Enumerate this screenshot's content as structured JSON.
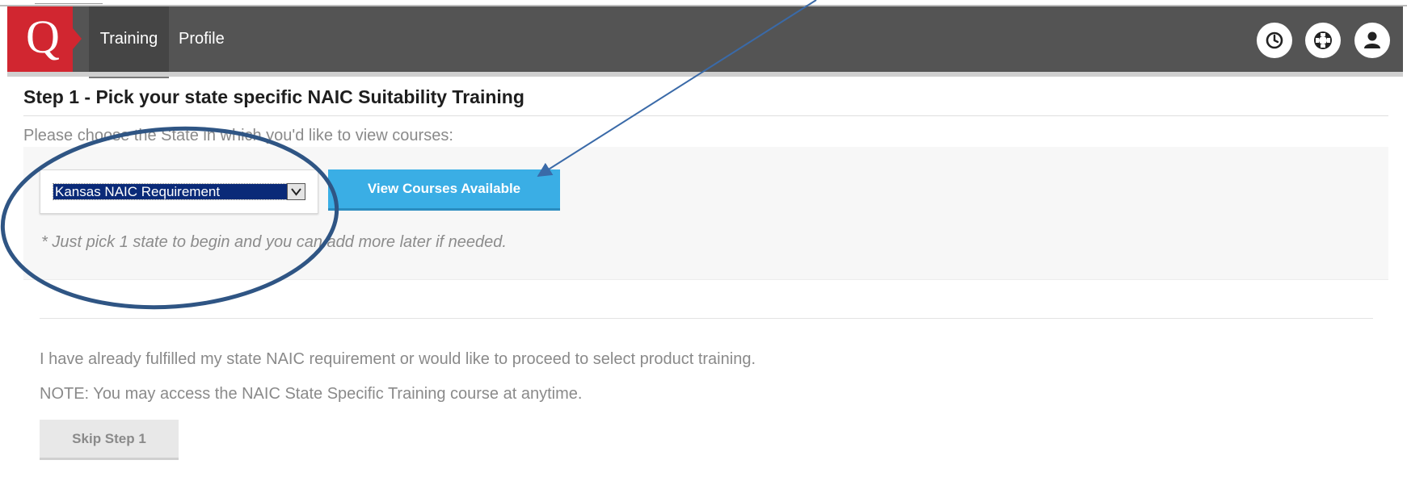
{
  "nav": {
    "logo_letter": "Q",
    "tabs": [
      {
        "label": "Training",
        "active": true
      },
      {
        "label": "Profile",
        "active": false
      }
    ],
    "icons": [
      "history-icon",
      "help-icon",
      "user-icon"
    ]
  },
  "step": {
    "title": "Step 1 - Pick your state specific NAIC Suitability Training",
    "instruction": "Please choose the State in which you'd like to view courses:",
    "state_select": {
      "selected": "Kansas NAIC Requirement"
    },
    "view_button_label": "View Courses Available",
    "hint": "* Just pick 1 state to begin and you can add more later if needed."
  },
  "skip": {
    "fulfilled_text": "I have already fulfilled my state NAIC requirement or would like to proceed to select product training.",
    "note_text": "NOTE: You may access the NAIC State Specific Training course at anytime.",
    "skip_button_label": "Skip Step 1"
  },
  "colors": {
    "navbar": "#545454",
    "brand_red": "#d12630",
    "primary_button": "#3aaee5",
    "annotation": "#2f5584"
  }
}
